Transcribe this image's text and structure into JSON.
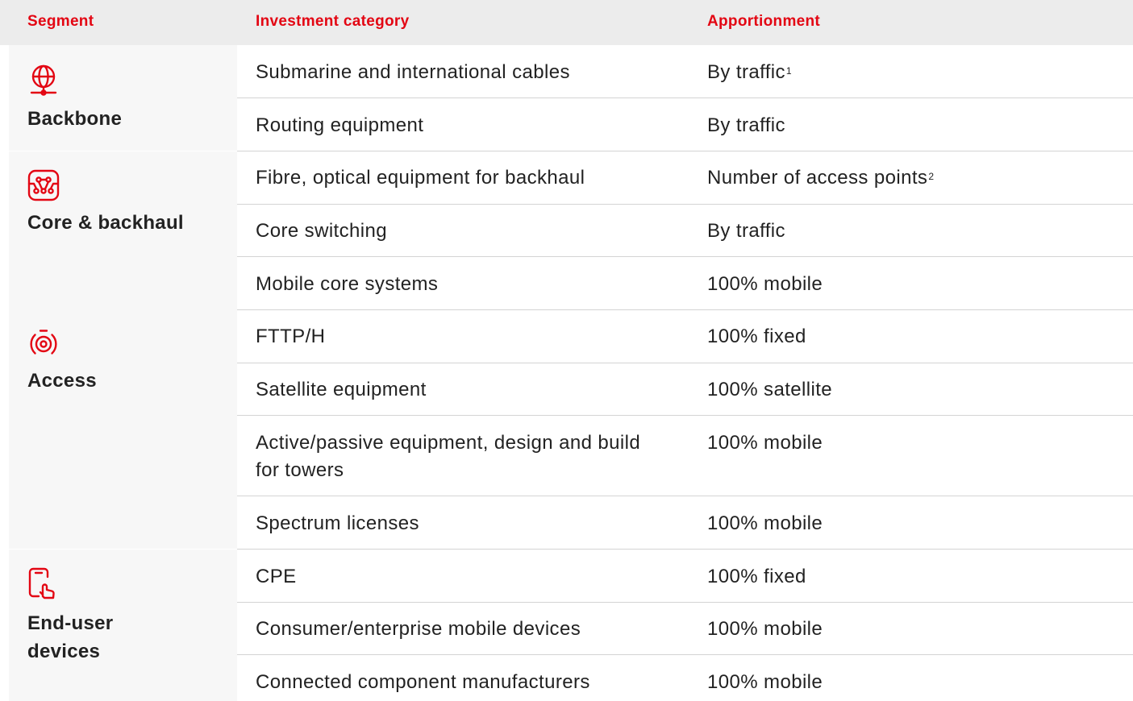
{
  "colors": {
    "accent": "#e30613",
    "header_bg": "#ececec",
    "band_bg": "#f7f7f7",
    "divider": "#d4d4d4",
    "text": "#222222"
  },
  "header": {
    "segment": "Segment",
    "category": "Investment category",
    "apportionment": "Apportionment"
  },
  "segments": [
    {
      "label": "Backbone",
      "icon": "globe-pin-icon",
      "rows": [
        {
          "category": "Submarine and international cables",
          "apportionment": "By traffic",
          "footnote": "1"
        },
        {
          "category": "Routing equipment",
          "apportionment": "By traffic",
          "footnote": ""
        }
      ]
    },
    {
      "label": "Core & backhaul",
      "icon": "circuit-board-icon",
      "rows": [
        {
          "category": "Fibre, optical equipment for backhaul",
          "apportionment": "Number of access points",
          "footnote": "2"
        },
        {
          "category": "Core switching",
          "apportionment": "By traffic",
          "footnote": ""
        },
        {
          "category": "Mobile core systems",
          "apportionment": "100% mobile",
          "footnote": ""
        }
      ]
    },
    {
      "label": "Access",
      "icon": "broadcast-signal-icon",
      "rows": [
        {
          "category": "FTTP/H",
          "apportionment": "100% fixed",
          "footnote": ""
        },
        {
          "category": "Satellite equipment",
          "apportionment": "100% satellite",
          "footnote": ""
        },
        {
          "category": "Active/passive equipment, design and build for towers",
          "apportionment": "100% mobile",
          "footnote": ""
        },
        {
          "category": "Spectrum licenses",
          "apportionment": "100% mobile",
          "footnote": ""
        }
      ]
    },
    {
      "label": "End-user devices",
      "icon": "mobile-touch-icon",
      "rows": [
        {
          "category": "CPE",
          "apportionment": "100% fixed",
          "footnote": ""
        },
        {
          "category": "Consumer/enterprise mobile devices",
          "apportionment": "100% mobile",
          "footnote": ""
        },
        {
          "category": "Connected component manufacturers",
          "apportionment": "100% mobile",
          "footnote": ""
        }
      ]
    }
  ]
}
